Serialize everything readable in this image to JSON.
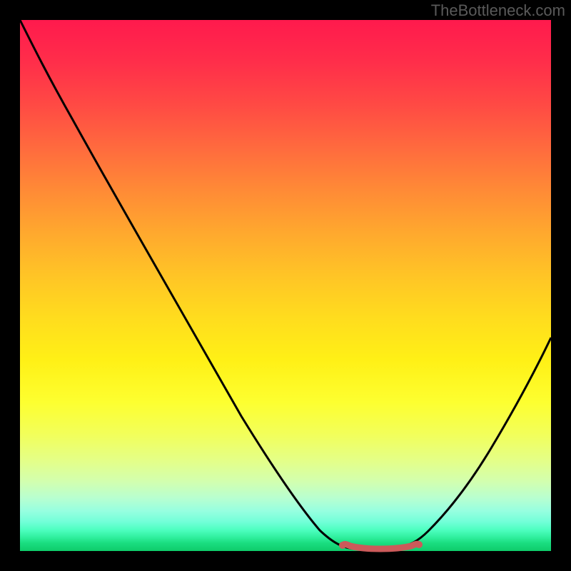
{
  "watermark": "TheBottleneck.com",
  "chart_data": {
    "type": "line",
    "title": "",
    "xlabel": "",
    "ylabel": "",
    "xlim": [
      0,
      100
    ],
    "ylim": [
      0,
      100
    ],
    "grid": false,
    "legend": false,
    "series": [
      {
        "name": "bottleneck-curve",
        "color": "#000000",
        "x": [
          0,
          5,
          10,
          15,
          20,
          25,
          30,
          35,
          40,
          45,
          50,
          55,
          58,
          62,
          65,
          68,
          70,
          72,
          75,
          80,
          85,
          90,
          95,
          100
        ],
        "values": [
          100,
          92,
          84,
          76,
          68,
          60,
          52,
          44,
          36,
          28,
          20,
          12,
          6,
          2.5,
          1.2,
          0.8,
          0.8,
          1.0,
          2.5,
          8,
          15,
          23,
          31,
          40
        ]
      }
    ],
    "annotations": [
      {
        "name": "optimal-range-marker",
        "type": "segment",
        "color": "#cc5a5a",
        "x": [
          62,
          75
        ],
        "y": [
          1.0,
          1.0
        ]
      }
    ],
    "palette": {
      "bg_black": "#000000",
      "grad_top": "#ff1a4d",
      "grad_mid": "#ffdc1e",
      "grad_bottom": "#0ecc6a",
      "curve": "#000000",
      "marker": "#cc5a5a",
      "watermark": "#5a5a5a"
    }
  }
}
